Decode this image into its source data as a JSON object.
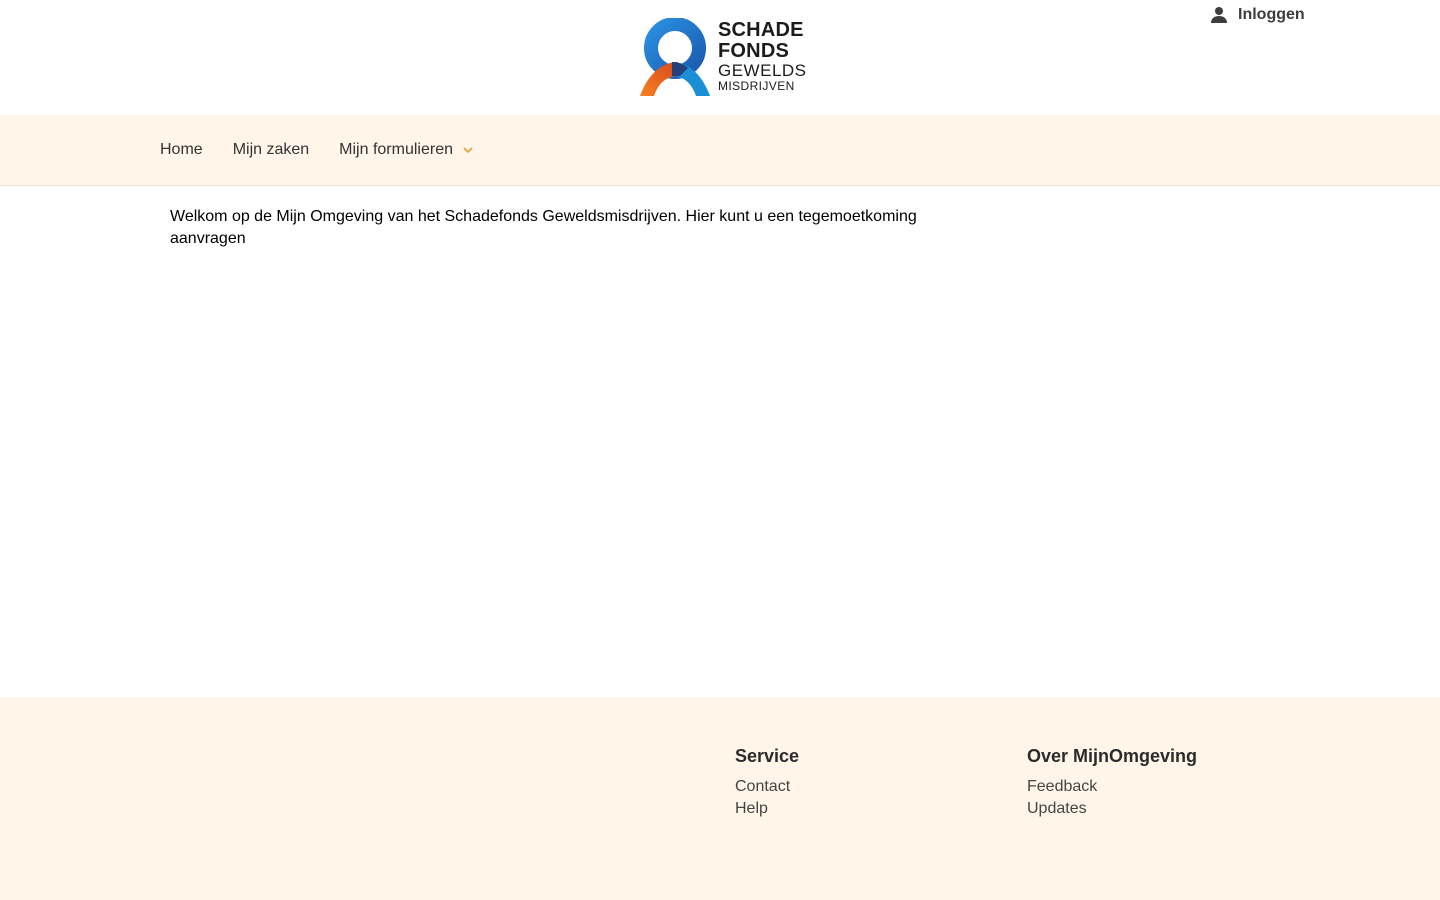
{
  "header": {
    "logo": {
      "line1": "SCHADE",
      "line2": "FONDS",
      "line3": "GEWELDS",
      "line4": "MISDRIJVEN",
      "colors": {
        "blue": "#1a73c8",
        "orange": "#f07d1a",
        "navy": "#26336b"
      }
    },
    "login": {
      "icon": "user-icon",
      "label": "Inloggen"
    }
  },
  "nav": {
    "items": [
      {
        "label": "Home"
      },
      {
        "label": "Mijn zaken"
      },
      {
        "label": "Mijn formulieren",
        "icon": "chevron-down-icon"
      }
    ],
    "accent": "#e8a33c"
  },
  "main": {
    "welcome_text": "Welkom op de Mijn Omgeving van het Schadefonds Geweldsmisdrijven. Hier kunt u een tegemoetkoming aanvragen"
  },
  "footer": {
    "service": {
      "heading": "Service",
      "links": [
        "Contact",
        "Help"
      ]
    },
    "about": {
      "heading": "Over MijnOmgeving",
      "links": [
        "Feedback",
        "Updates"
      ]
    },
    "background": "#fff5e9"
  }
}
